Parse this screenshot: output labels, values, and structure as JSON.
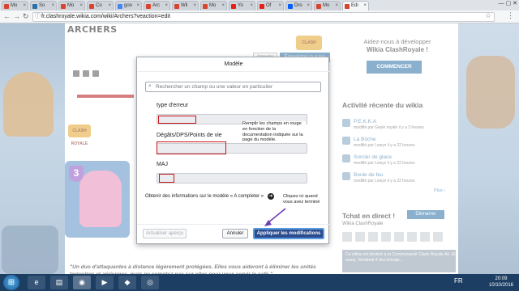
{
  "browser": {
    "tabs": [
      {
        "label": "Mo",
        "color": "#d9442e"
      },
      {
        "label": "So",
        "color": "#2a6fa5"
      },
      {
        "label": "Mo",
        "color": "#d9442e"
      },
      {
        "label": "Co",
        "color": "#d9442e"
      },
      {
        "label": "goo",
        "color": "#4285f4"
      },
      {
        "label": "Arc",
        "color": "#d9442e"
      },
      {
        "label": "Wil",
        "color": "#d9442e"
      },
      {
        "label": "Mo",
        "color": "#d9442e"
      },
      {
        "label": "Yo",
        "color": "#e62117"
      },
      {
        "label": "Of",
        "color": "#e62117"
      },
      {
        "label": "Dro",
        "color": "#0061fe"
      },
      {
        "label": "Mo",
        "color": "#d9442e"
      },
      {
        "label": "Edi",
        "color": "#d9442e"
      }
    ],
    "active_tab_index": 12,
    "url": "fr.clashroyale.wikia.com/wiki/Archers?veaction=edit",
    "user_control": "—  ▢  ✕"
  },
  "page": {
    "wiki_name": "ARCHERS",
    "logo_text": "CLASH ROYALE",
    "toolbar": {
      "annuler": "Annuler",
      "save": "Enregistrer la page"
    },
    "card_level": "3",
    "bottom_text": "\"Un duo d'attaquantes à distance légèrement protégées. Elles vous aideront à éliminer les unités terrestres et aériennes, mais ne comptez pas sur elles pour vous servir le café.\""
  },
  "rail": {
    "promo_line1": "Aidez-nous à développer",
    "promo_line2": "Wikia ClashRoyale !",
    "commencer": "COMMENCER",
    "activity_title": "Activité récente du wikia",
    "activity": [
      {
        "title": "P.E.K.K.A",
        "meta": "modifié par Geyle royale il y a 3 heures"
      },
      {
        "title": "La Bûche",
        "meta": "modifié par Lowyx il y a 22 heures"
      },
      {
        "title": "Sorcier de glace",
        "meta": "modifié par Lowyx il y a 22 heures"
      },
      {
        "title": "Boule de feu",
        "meta": "modifié par Lowyx il y a 22 heures"
      }
    ],
    "plus": "Plus ›",
    "chat_title": "Tchat en direct !",
    "chat_button": "Démarrer",
    "chat_sub": "Wikia ClashRoyale",
    "promo_img_text": "Ce wikia est destiné à la Communauté Clash Royale\nAil. Et aussi, Vendredi 4 des Emojis..."
  },
  "modal": {
    "title": "Modèle",
    "search_placeholder": "Rechercher un champ ou une valeur en particulier",
    "fields": [
      {
        "label": "type d'erreur",
        "value": ""
      },
      {
        "label": "Dégâts/DPS/Points de vie",
        "value": ""
      },
      {
        "label": "MAJ",
        "value": ""
      }
    ],
    "note": "Remplir les champs en rouge en fonction de la documentation indiquée sur la page du modèle.",
    "more_info": "Obtenir des informations sur le modèle « A completer »",
    "hint": "Cliquez ici quand vous avez terminé",
    "preview_button": "Actualiser aperçu",
    "cancel_button": "Annuler",
    "apply_button": "Appliquer les modifications"
  },
  "taskbar": {
    "tray": "FR",
    "time": "20:09",
    "date": "10/10/2016"
  },
  "colors": {
    "accent": "#2a6fa5",
    "apply": "#2a4b8d",
    "highlight": "#c4161c",
    "annotation_arrow": "#6a3fb5"
  }
}
